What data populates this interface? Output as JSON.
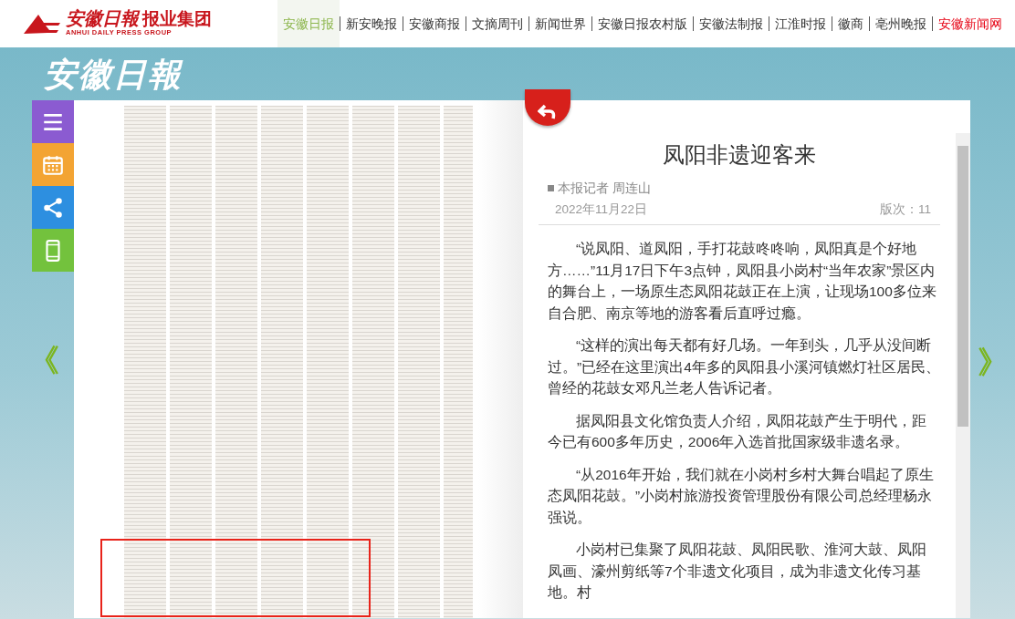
{
  "header": {
    "logo": {
      "name": "安徽日報",
      "suffix": "报业集团",
      "english": "ANHUI DAILY PRESS GROUP"
    },
    "nav": [
      {
        "label": "安徽日报",
        "selected": true,
        "kind": "paper"
      },
      {
        "label": "新安晚报",
        "selected": false,
        "kind": "paper"
      },
      {
        "label": "安徽商报",
        "selected": false,
        "kind": "paper"
      },
      {
        "label": "文摘周刊",
        "selected": false,
        "kind": "paper"
      },
      {
        "label": "新闻世界",
        "selected": false,
        "kind": "paper"
      },
      {
        "label": "安徽日报农村版",
        "selected": false,
        "kind": "paper"
      },
      {
        "label": "安徽法制报",
        "selected": false,
        "kind": "paper"
      },
      {
        "label": "江淮时报",
        "selected": false,
        "kind": "paper"
      },
      {
        "label": "徽商",
        "selected": false,
        "kind": "paper"
      },
      {
        "label": "亳州晚报",
        "selected": false,
        "kind": "paper"
      },
      {
        "label": "安徽新闻网",
        "selected": false,
        "kind": "portal"
      }
    ]
  },
  "masthead": {
    "title": "安徽日報"
  },
  "sidebar": [
    {
      "kind": "menu"
    },
    {
      "kind": "calendar"
    },
    {
      "kind": "share"
    },
    {
      "kind": "mobile"
    }
  ],
  "pager": {
    "previous": "《",
    "next": "》"
  },
  "article": {
    "title": "凤阳非遗迎客来",
    "byline": "本报记者 周连山",
    "date": "2022年11月22日",
    "edition": "版次：11",
    "paragraphs": [
      "“说凤阳、道凤阳，手打花鼓咚咚响，凤阳真是个好地方……”11月17日下午3点钟，凤阳县小岗村“当年农家”景区内的舞台上，一场原生态凤阳花鼓正在上演，让现场100多位来自合肥、南京等地的游客看后直呼过瘾。",
      "“这样的演出每天都有好几场。一年到头，几乎从没间断过。”已经在这里演出4年多的凤阳县小溪河镇燃灯社区居民、曾经的花鼓女邓凡兰老人告诉记者。",
      "据凤阳县文化馆负责人介绍，凤阳花鼓产生于明代，距今已有600多年历史，2006年入选首批国家级非遗名录。",
      "“从2016年开始，我们就在小岗村乡村大舞台唱起了原生态凤阳花鼓。”小岗村旅游投资管理股份有限公司总经理杨永强说。",
      "小岗村已集聚了凤阳花鼓、凤阳民歌、淮河大鼓、凤阳凤画、濠州剪纸等7个非遗文化项目，成为非遗文化传习基地。村"
    ]
  }
}
